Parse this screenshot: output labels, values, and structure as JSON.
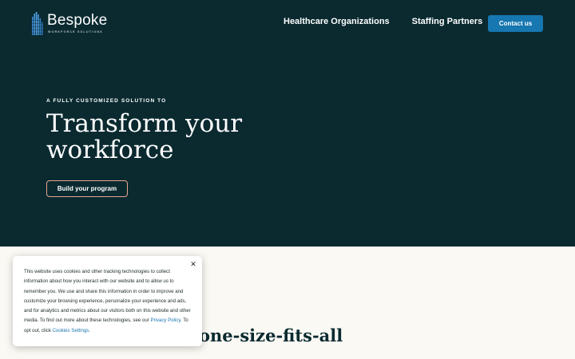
{
  "brand": {
    "name": "Bespoke",
    "tagline": "WORKFORCE SOLUTIONS",
    "logo_icon": "building-bars-icon"
  },
  "nav": {
    "items": [
      "Healthcare Organizations",
      "Staffing Partners"
    ],
    "cta": "Contact us"
  },
  "hero": {
    "eyebrow": "A FULLY CUSTOMIZED SOLUTION TO",
    "title": "Transform your workforce",
    "button": "Build your program"
  },
  "section": {
    "heading_visible": "one-size-fits-all",
    "body_visible": ""
  },
  "cookie_banner": {
    "close_icon": "close-icon",
    "text_before": "This website uses cookies and other tracking technologies to collect information about how you interact with our website and to allow us to remember you. We use and share this information in order to improve and customize your browsing experience, personalize your experience and ads, and for analytics and metrics about our visitors both on this website and other media. To find out more about these technologies, see our ",
    "privacy_link": "Privacy Policy",
    "text_middle": ". To opt out, click ",
    "settings_link": "Cookies Settings",
    "text_after": "."
  },
  "colors": {
    "hero_bg": "#0a2a30",
    "accent": "#1777b0",
    "button_border": "#e9a58e",
    "page_bg": "#fbf9f4"
  }
}
